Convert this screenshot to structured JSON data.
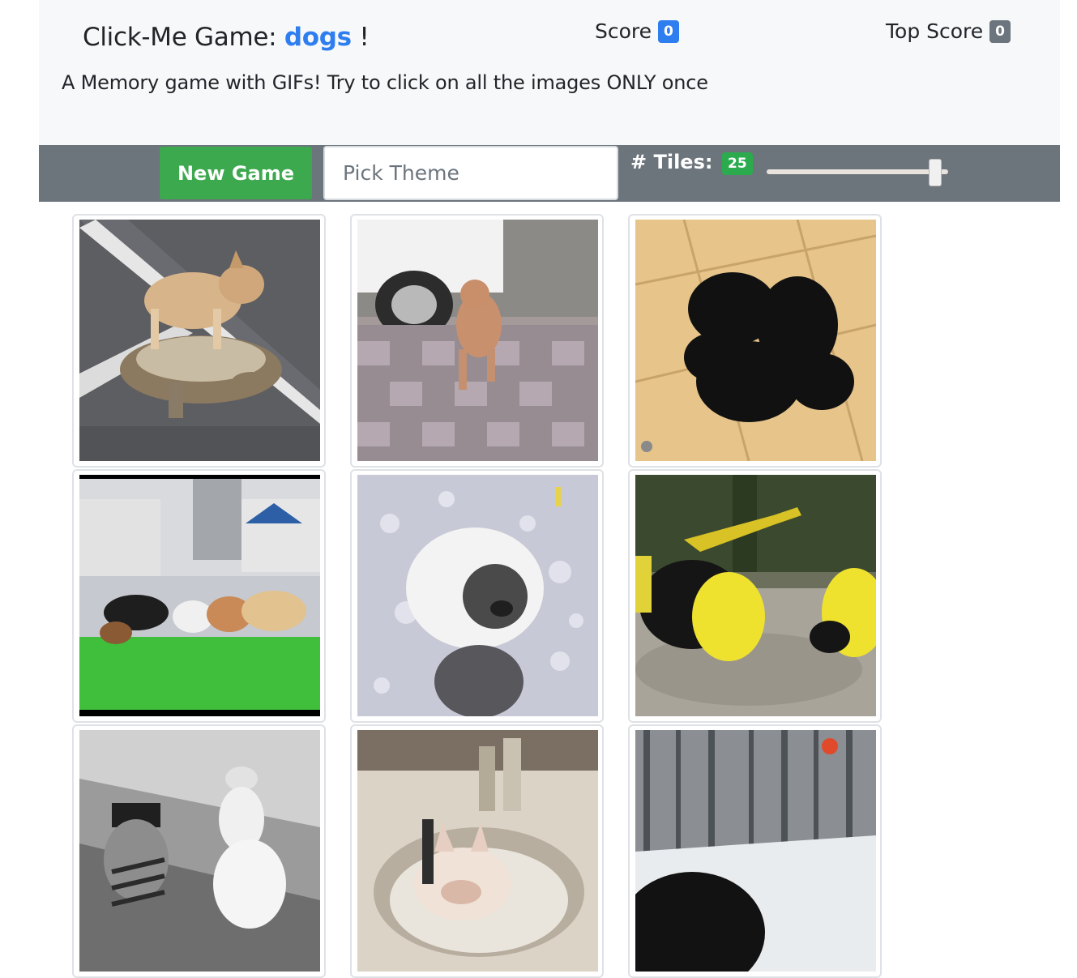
{
  "header": {
    "title_prefix": "Click-Me Game: ",
    "theme": "dogs",
    "title_suffix": " !",
    "subtitle": "A Memory game with GIFs! Try to click on all the images ONLY once"
  },
  "score": {
    "label": "Score",
    "value": "0"
  },
  "top_score": {
    "label": "Top Score",
    "value": "0"
  },
  "toolbar": {
    "new_game_label": "New Game",
    "theme_placeholder": "Pick Theme",
    "tiles_label": "# Tiles:",
    "tiles_value": "25",
    "tiles_slider_fraction": 0.93
  },
  "colors": {
    "accent_blue": "#2f7ef0",
    "success_green": "#3da94f",
    "toolbar_grey": "#6c747c"
  },
  "tiles": [
    {
      "name": "dog-on-tortoise"
    },
    {
      "name": "dog-on-tile-pavement"
    },
    {
      "name": "black-puppies-pile"
    },
    {
      "name": "dogs-on-green-carpet"
    },
    {
      "name": "windblown-fluffy-dog"
    },
    {
      "name": "dogs-in-hard-hats"
    },
    {
      "name": "costumed-dogs-bw"
    },
    {
      "name": "bulldog-in-sink"
    },
    {
      "name": "dog-in-snow"
    }
  ]
}
